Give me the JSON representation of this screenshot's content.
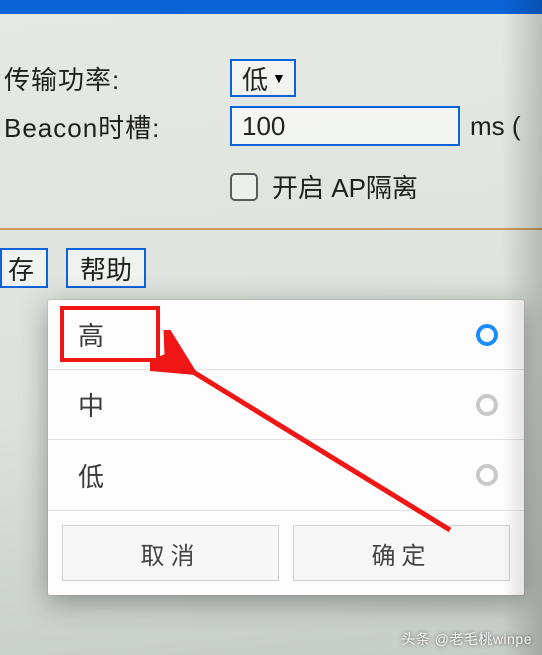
{
  "settings": {
    "tx_power_label": "传输功率:",
    "tx_power_value": "低",
    "beacon_label": "Beacon时槽:",
    "beacon_value": "100",
    "beacon_unit": "ms (",
    "ap_isolation_label": "开启 AP隔离"
  },
  "buttons": {
    "save_truncated": "存",
    "help": "帮助"
  },
  "picker": {
    "options": [
      {
        "label": "高",
        "selected": true
      },
      {
        "label": "中",
        "selected": false
      },
      {
        "label": "低",
        "selected": false
      }
    ],
    "cancel": "取消",
    "confirm": "确定"
  },
  "watermark": "头条 @老毛桃winpe"
}
